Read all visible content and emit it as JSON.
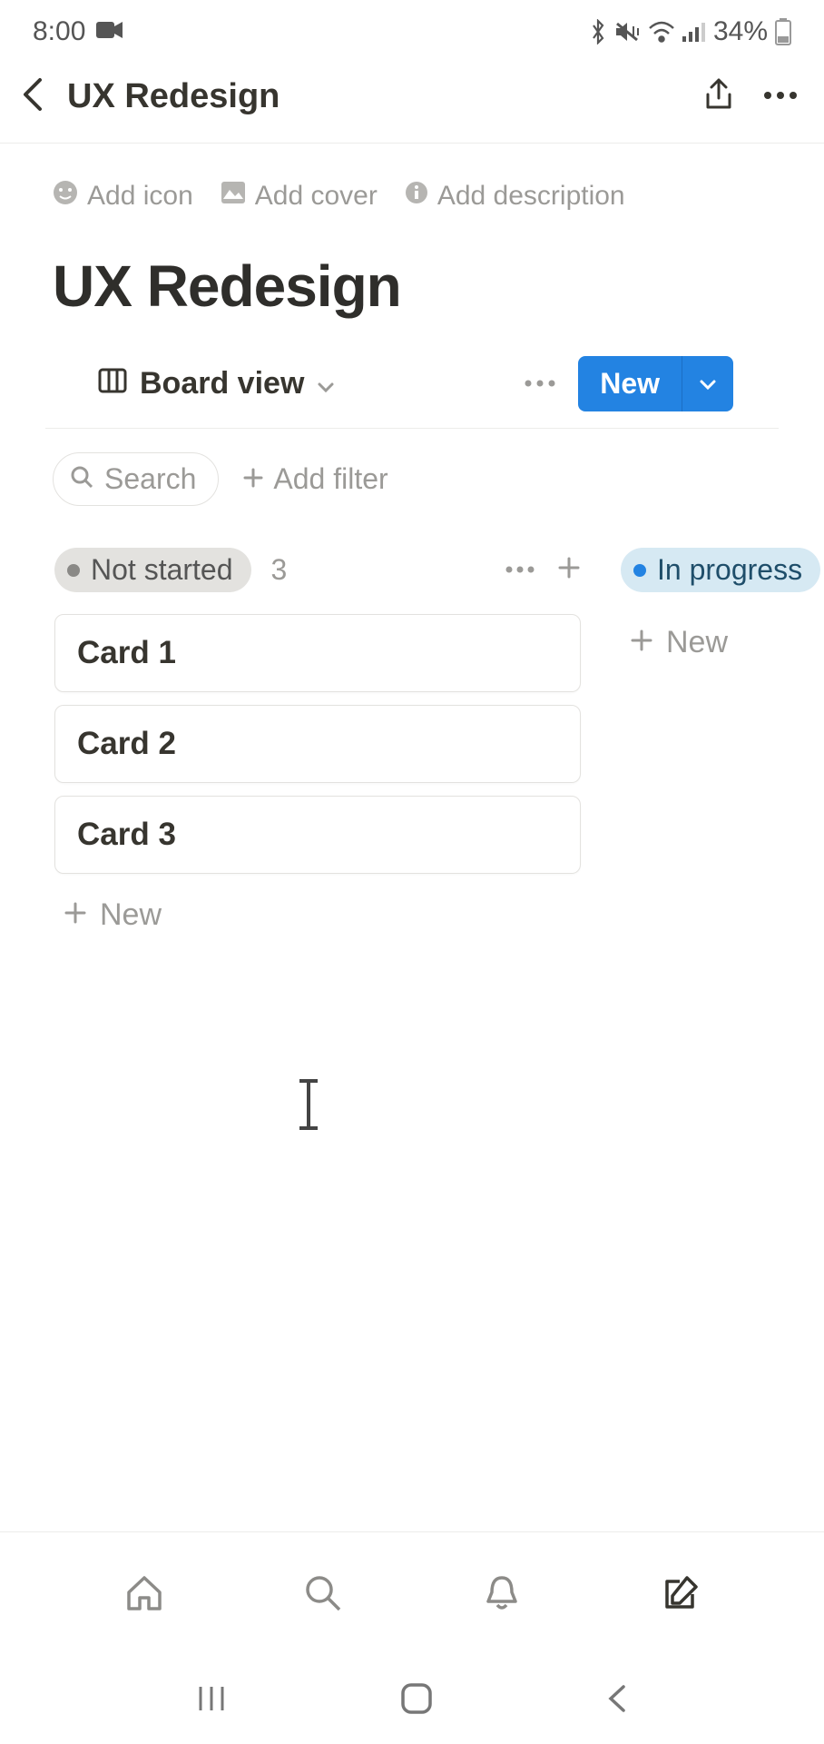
{
  "status_bar": {
    "time": "8:00",
    "battery_text": "34%"
  },
  "header": {
    "title": "UX Redesign"
  },
  "prelude": {
    "add_icon": "Add icon",
    "add_cover": "Add cover",
    "add_description": "Add description"
  },
  "page": {
    "title": "UX Redesign"
  },
  "view_row": {
    "current_view": "Board view",
    "new_label": "New"
  },
  "filter_row": {
    "search_placeholder": "Search",
    "add_filter": "Add filter"
  },
  "board": {
    "columns": [
      {
        "status_label": "Not started",
        "count": "3",
        "cards": [
          "Card 1",
          "Card 2",
          "Card 3"
        ],
        "new_label": "New"
      },
      {
        "status_label": "In progress",
        "new_label": "New"
      }
    ]
  }
}
